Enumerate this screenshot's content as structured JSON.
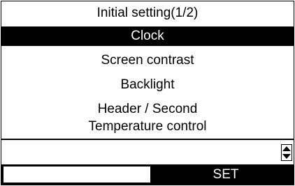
{
  "menu": {
    "title": "Initial setting(1/2)",
    "items": [
      {
        "label": "Clock",
        "selected": true
      },
      {
        "label": "Screen contrast",
        "selected": false
      },
      {
        "label": "Backlight",
        "selected": false
      },
      {
        "label": "Header / Second",
        "selected": false
      },
      {
        "label": "Temperature control",
        "selected": false
      }
    ]
  },
  "softkeys": {
    "left": "",
    "right": "SET"
  },
  "icons": {
    "scroll": "up-down-scroll-icon"
  },
  "colors": {
    "highlight_bg": "#000000",
    "highlight_fg": "#ffffff"
  }
}
